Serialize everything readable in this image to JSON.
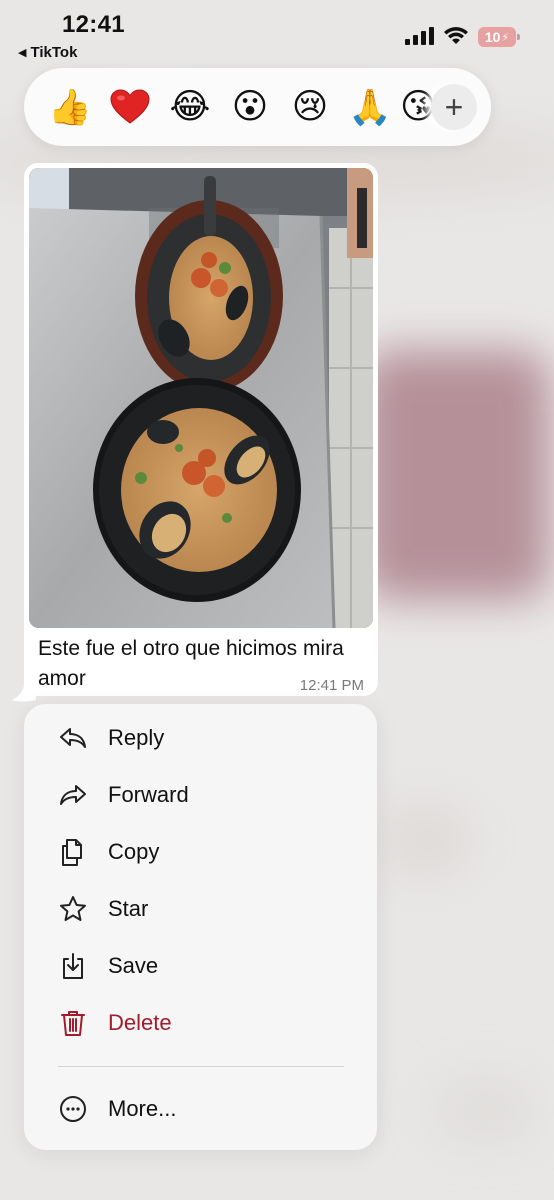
{
  "status_bar": {
    "time": "12:41",
    "back_app": "TikTok",
    "back_icon": "back-triangle-icon",
    "battery_level": "10"
  },
  "reactions": {
    "items": [
      "👍",
      "heart",
      "😂",
      "😮",
      "😢",
      "🙏",
      "😘"
    ],
    "add_label": "+"
  },
  "message": {
    "text": "Este fue el otro que hicimos mira amor",
    "time": "12:41 PM",
    "image_alt": "two plates of seafood pasta with mussels and shrimp"
  },
  "menu": {
    "items": [
      {
        "label": "Reply",
        "icon": "reply-icon"
      },
      {
        "label": "Forward",
        "icon": "forward-icon"
      },
      {
        "label": "Copy",
        "icon": "copy-icon"
      },
      {
        "label": "Star",
        "icon": "star-icon"
      },
      {
        "label": "Save",
        "icon": "save-icon"
      },
      {
        "label": "Delete",
        "icon": "trash-icon"
      }
    ],
    "more": {
      "label": "More...",
      "icon": "more-icon"
    }
  },
  "colors": {
    "danger": "#a31c2c",
    "heart": "#e02323",
    "bubble": "#ffffff"
  }
}
